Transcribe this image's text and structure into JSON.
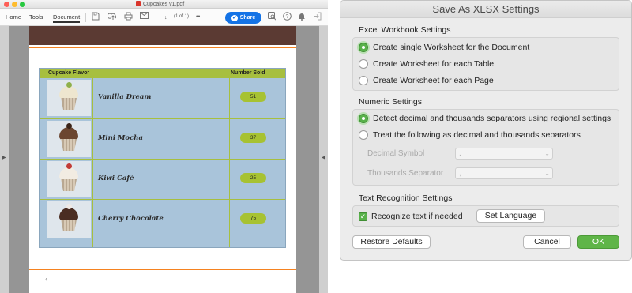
{
  "acrobat": {
    "window_title": "Cupcakes v1.pdf",
    "menu": [
      "Home",
      "Tools",
      "Document"
    ],
    "page_indicator": "(1 of 1)",
    "more": "•••",
    "share_label": "Share",
    "page_number": "4",
    "table": {
      "headers": [
        "Cupcake Flavor",
        "Number Sold"
      ],
      "rows": [
        {
          "flavor": "Vanilla Dream",
          "sold": "51"
        },
        {
          "flavor": "Mini Mocha",
          "sold": "37"
        },
        {
          "flavor": "Kiwi Café",
          "sold": "25"
        },
        {
          "flavor": "Cherry Chocolate",
          "sold": "75"
        }
      ]
    },
    "icons": {
      "save": "save-icon",
      "upload": "upload-icon",
      "print": "print-icon",
      "mail": "mail-icon",
      "zoom": "zoom-icon",
      "search": "search-icon",
      "help": "help-icon",
      "bell": "bell-icon",
      "signin": "sign-in-icon"
    },
    "colors": {
      "share": "#1473e6",
      "table_head": "#a7bf3f",
      "table_body": "#a9c4da",
      "band": "#5b3a33",
      "rule": "#f58220"
    }
  },
  "dialog": {
    "title": "Save As XLSX Settings",
    "excel_section": {
      "label": "Excel Workbook Settings",
      "options": [
        {
          "label": "Create single Worksheet for the Document",
          "selected": true
        },
        {
          "label": "Create Worksheet for each Table",
          "selected": false
        },
        {
          "label": "Create Worksheet for each Page",
          "selected": false
        }
      ]
    },
    "numeric_section": {
      "label": "Numeric Settings",
      "options": [
        {
          "label": "Detect decimal and thousands separators using regional settings",
          "selected": true
        },
        {
          "label": "Treat the following as decimal and thousands separators",
          "selected": false
        }
      ],
      "decimal_symbol_label": "Decimal Symbol",
      "decimal_symbol_value": ".",
      "thousands_separator_label": "Thousands Separator",
      "thousands_separator_value": ","
    },
    "text_section": {
      "label": "Text Recognition Settings",
      "recognize_label": "Recognize text if needed",
      "recognize_checked": true,
      "set_language_label": "Set Language"
    },
    "buttons": {
      "restore": "Restore Defaults",
      "cancel": "Cancel",
      "ok": "OK"
    },
    "colors": {
      "accent": "#58b14a"
    }
  }
}
